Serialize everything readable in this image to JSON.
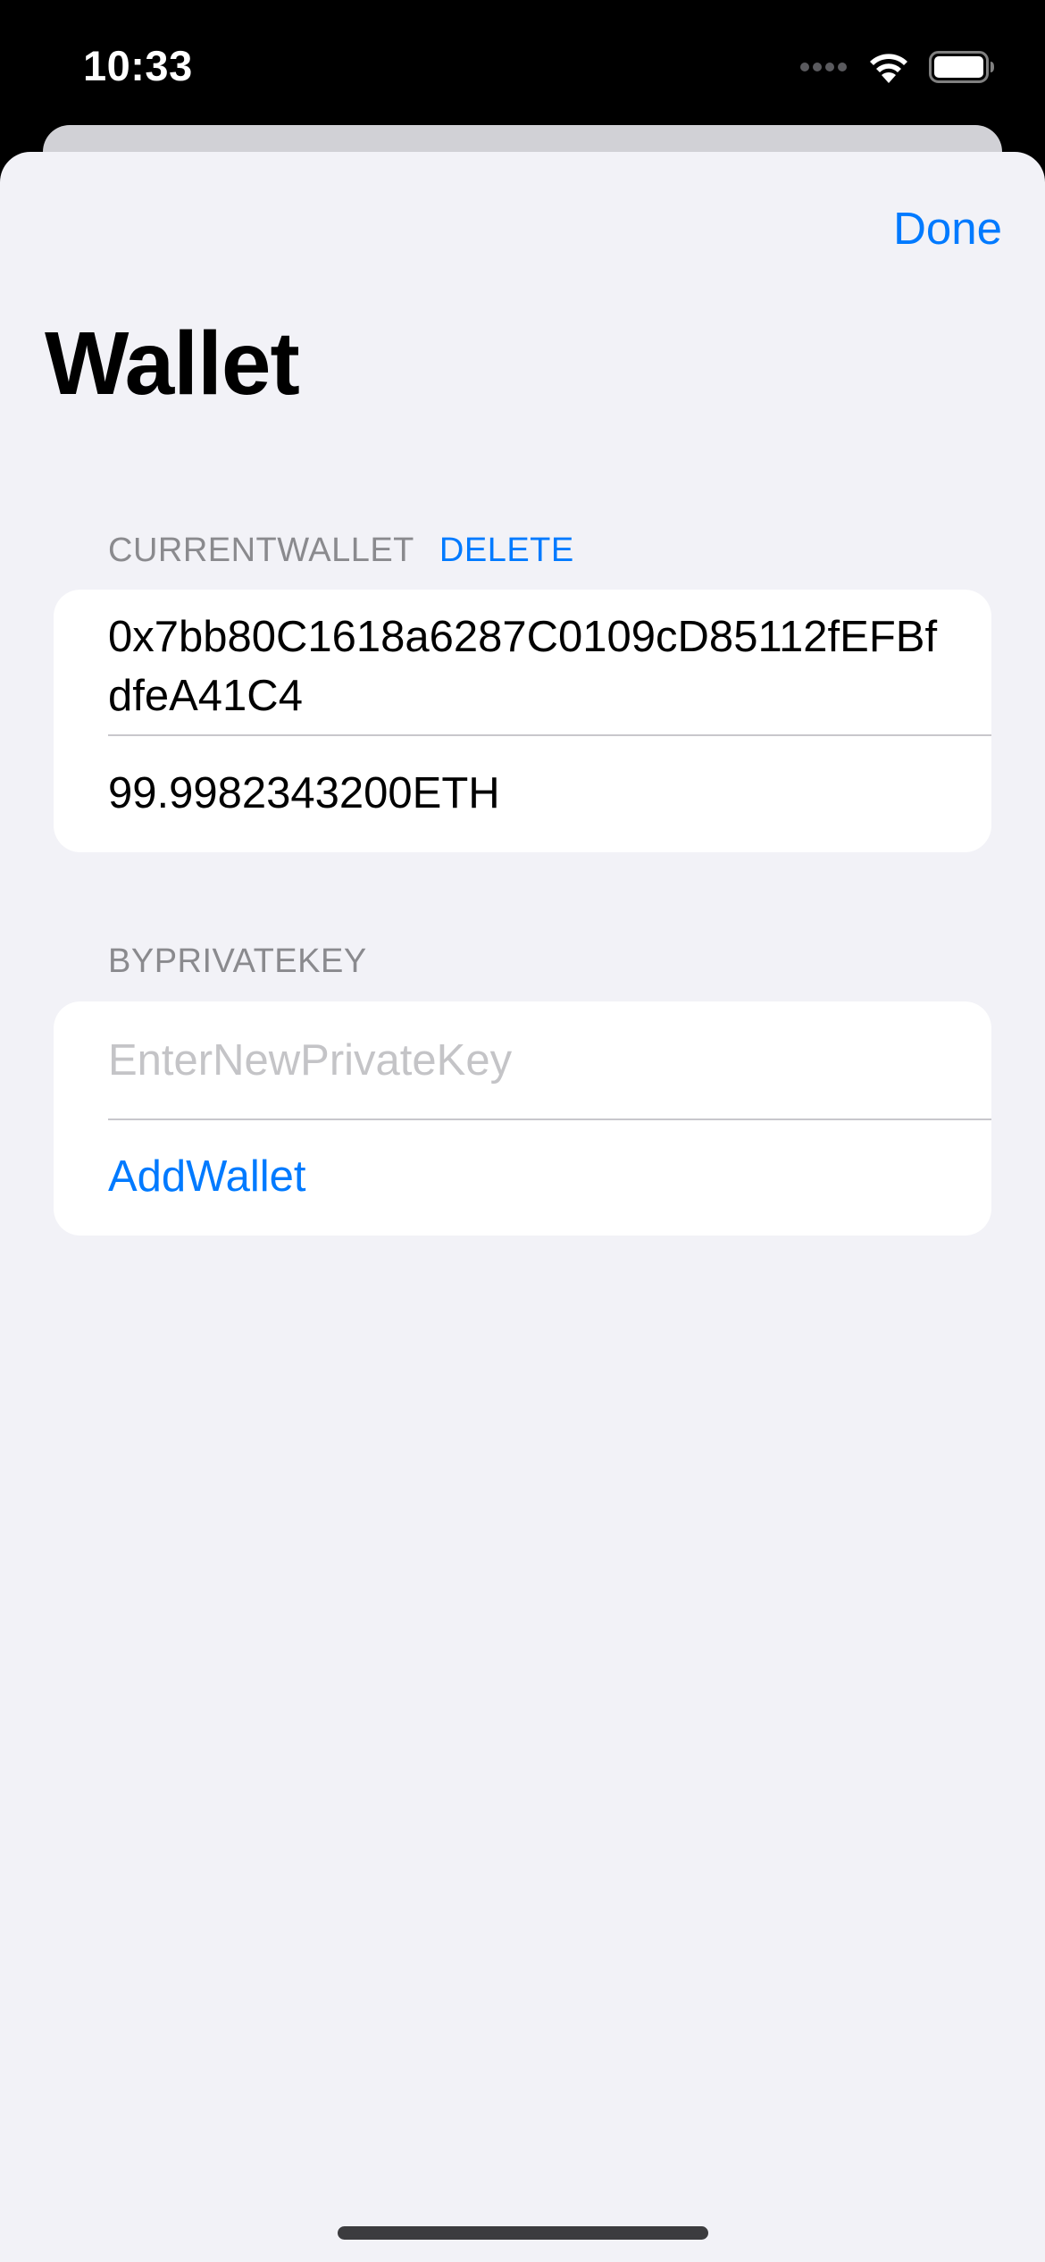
{
  "status_bar": {
    "time": "10:33",
    "icons": [
      "cellular-signal-icon",
      "wifi-icon",
      "battery-icon"
    ]
  },
  "navigation": {
    "done_label": "Done",
    "title": "Wallet"
  },
  "current_wallet": {
    "header": "CURRENTWALLET",
    "delete_label": "DELETE",
    "address": "0x7bb80C1618a6287C0109cD85112fEFBfdfeA41C4",
    "balance": "99.9982343200ETH"
  },
  "private_key": {
    "header": "BYPRIVATEKEY",
    "input_value": "",
    "input_placeholder": "EnterNewPrivateKey",
    "add_label": "AddWallet"
  },
  "colors": {
    "accent": "#007aff",
    "background": "#f2f2f7",
    "card": "#ffffff",
    "secondary_text": "#8a8a8e",
    "separator": "#c8c7cc"
  }
}
